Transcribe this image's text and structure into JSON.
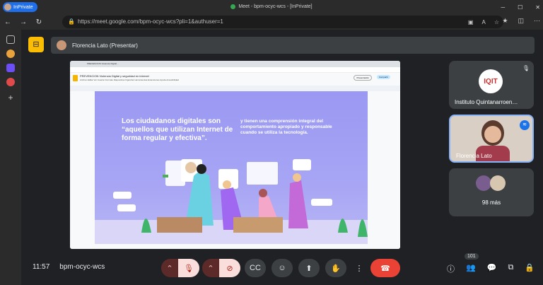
{
  "browser": {
    "inprivate_label": "InPrivate",
    "window_title": "Meet - bpm-ocyc-wcs - [InPrivate]",
    "url": "https://meet.google.com/bpm-ocyc-wcs?pli=1&authuser=1"
  },
  "meet": {
    "presenter_label": "Florencia Lato (Presentar)",
    "participants": [
      {
        "name": "Instituto Quintanarroen…",
        "logo_text": "IQIT"
      },
      {
        "name": "Florencia Lato"
      },
      {
        "name": "98 más"
      }
    ],
    "clock": "11:57",
    "meeting_code": "bpm-ocyc-wcs",
    "participant_count": "101"
  },
  "shared_screen": {
    "tab_title": "PREVENCION Violencia Digital…",
    "doc_title": "PREVENCION Violencia Digital y seguridad en internet",
    "doc_menu": "Archivo  Editar  Ver  Insertar  Formato  Diapositiva  Organizar  Herramientas  Extensiones  Ayuda  Accesibilidad",
    "present_button": "Presentación",
    "share_button": "Compartir",
    "slide_quote": "Los ciudadanos digitales son “aquellos que utilizan Internet de forma regular y efectiva”.",
    "slide_text": "y tienen una comprensión integral del comportamiento apropiado y responsable cuando se utiliza la tecnología."
  },
  "colors": {
    "accent_yellow": "#fbbc04",
    "end_call": "#ea4335",
    "slide_bg": "#9a98f2"
  }
}
